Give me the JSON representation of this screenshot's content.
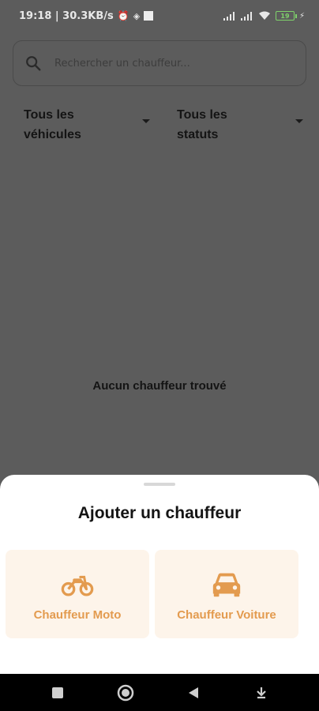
{
  "status_bar": {
    "time_speed": "19:18 | 30.3KB/s",
    "battery_level": "19"
  },
  "search": {
    "placeholder": "Rechercher un chauffeur..."
  },
  "filters": {
    "vehicles": "Tous les véhicules",
    "statuses": "Tous les statuts"
  },
  "empty_state": "Aucun chauffeur trouvé",
  "bottom_sheet": {
    "title": "Ajouter un chauffeur",
    "options": [
      {
        "label": "Chauffeur Moto",
        "icon": "motorcycle-icon"
      },
      {
        "label": "Chauffeur Voiture",
        "icon": "car-icon"
      }
    ]
  },
  "colors": {
    "accent": "#e39b4f",
    "option_bg": "#fdf4ea",
    "overlay": "#5c5c5c"
  }
}
